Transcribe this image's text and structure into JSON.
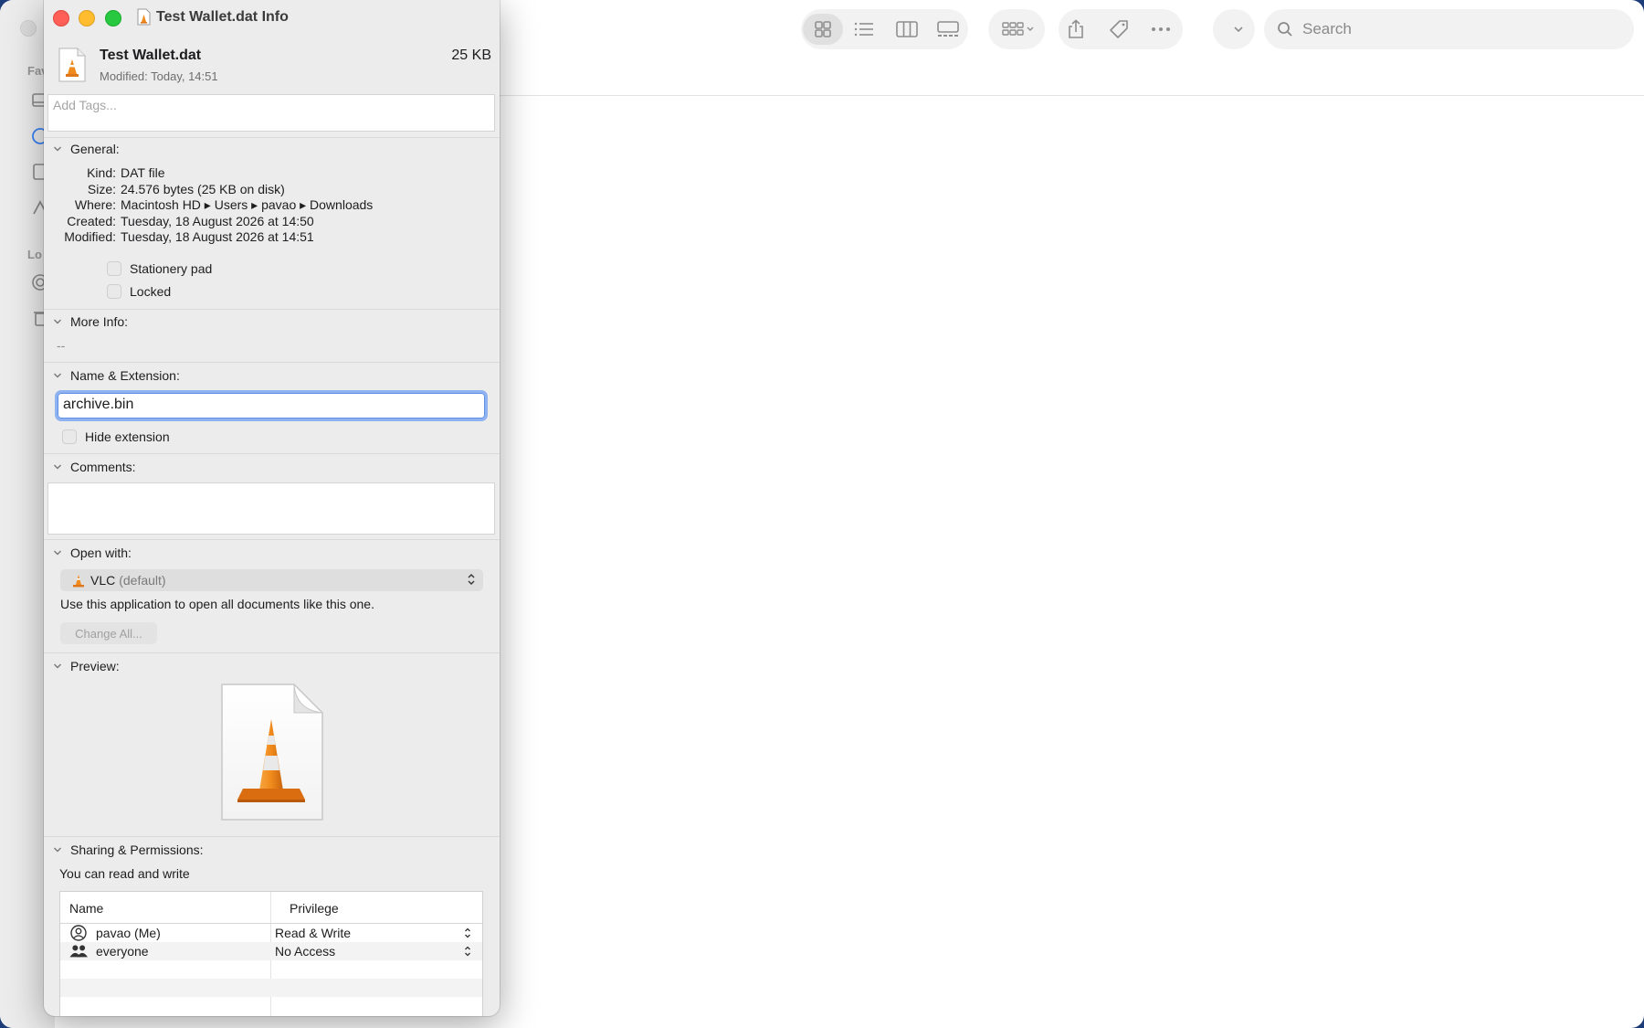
{
  "finder": {
    "sidebar_labels": [
      "Fav",
      "Lo"
    ],
    "search_placeholder": "Search"
  },
  "info": {
    "window_title": "Test Wallet.dat Info",
    "file_name": "Test Wallet.dat",
    "file_size": "25 KB",
    "modified_summary": "Modified: Today, 14:51",
    "tags_placeholder": "Add Tags...",
    "general": {
      "heading": "General:",
      "rows": [
        {
          "key": "Kind:",
          "value": "DAT file"
        },
        {
          "key": "Size:",
          "value": "24.576 bytes (25 KB on disk)"
        },
        {
          "key": "Where:",
          "value": "Macintosh HD ▸ Users ▸ pavao ▸ Downloads"
        },
        {
          "key": "Created:",
          "value": "Tuesday, 18 August 2026 at 14:50"
        },
        {
          "key": "Modified:",
          "value": "Tuesday, 18 August 2026 at 14:51"
        }
      ],
      "stationery_label": "Stationery pad",
      "locked_label": "Locked"
    },
    "more_info": {
      "heading": "More Info:",
      "value": "--"
    },
    "name_extension": {
      "heading": "Name & Extension:",
      "value": "archive.bin",
      "hide_label": "Hide extension"
    },
    "comments": {
      "heading": "Comments:"
    },
    "open_with": {
      "heading": "Open with:",
      "app": "VLC",
      "default_tag": "(default)",
      "description": "Use this application to open all documents like this one.",
      "change_all": "Change All..."
    },
    "preview": {
      "heading": "Preview:"
    },
    "sharing": {
      "heading": "Sharing & Permissions:",
      "status": "You can read and write",
      "col_name": "Name",
      "col_privilege": "Privilege",
      "rows": [
        {
          "name": "pavao (Me)",
          "privilege": "Read & Write"
        },
        {
          "name": "everyone",
          "privilege": "No Access"
        }
      ]
    }
  }
}
